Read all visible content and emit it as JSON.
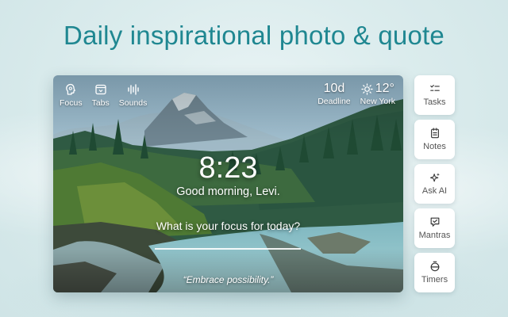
{
  "headline": "Daily inspirational photo & quote",
  "toolbar": {
    "items": [
      {
        "label": "Focus",
        "icon": "head-icon"
      },
      {
        "label": "Tabs",
        "icon": "tabs-icon"
      },
      {
        "label": "Sounds",
        "icon": "soundwave-icon"
      }
    ]
  },
  "widgets": {
    "deadline": {
      "value": "10d",
      "label": "Deadline"
    },
    "weather": {
      "temp": "12°",
      "location": "New York",
      "icon": "sun-icon"
    }
  },
  "clock": "8:23",
  "greeting": "Good morning, Levi.",
  "focus_prompt": "What is your focus for today?",
  "quote": "“Embrace possibility.”",
  "sidebar": {
    "items": [
      {
        "label": "Tasks",
        "icon": "checklist-icon"
      },
      {
        "label": "Notes",
        "icon": "notepad-icon"
      },
      {
        "label": "Ask AI",
        "icon": "sparkle-icon"
      },
      {
        "label": "Mantras",
        "icon": "chat-check-icon"
      },
      {
        "label": "Timers",
        "icon": "timer-icon"
      }
    ]
  },
  "colors": {
    "headline": "#1f8791",
    "background": "#dbeced",
    "card": "#ffffff"
  }
}
